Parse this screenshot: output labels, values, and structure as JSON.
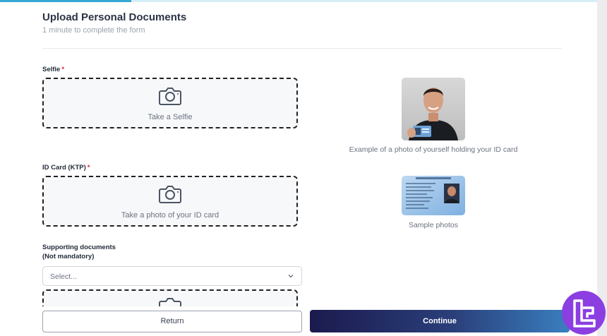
{
  "form": {
    "title": "Upload Personal Documents",
    "subtitle": "1 minute to complete the form",
    "progress": 0.22
  },
  "selfie": {
    "label": "Selfie",
    "required_mark": "*",
    "dropzone_text": "Take a Selfie",
    "icon": "camera-icon",
    "example_caption": "Example of a photo of yourself holding your ID card"
  },
  "id_card": {
    "label": "ID Card (KTP)",
    "required_mark": "*",
    "dropzone_text": "Take a photo of your ID card",
    "icon": "camera-icon",
    "example_caption": "Sample photos"
  },
  "supporting": {
    "label": "Supporting documents",
    "note": "(Not mandatory)",
    "select_placeholder": "Select...",
    "icon": "camera-icon"
  },
  "actions": {
    "return_label": "Return",
    "continue_label": "Continue"
  },
  "colors": {
    "accent": "#38a6d6",
    "required": "#e11d48",
    "continue_start": "#1c1a4e",
    "continue_end": "#3a7fc0",
    "logo": "#8b3fe0"
  }
}
